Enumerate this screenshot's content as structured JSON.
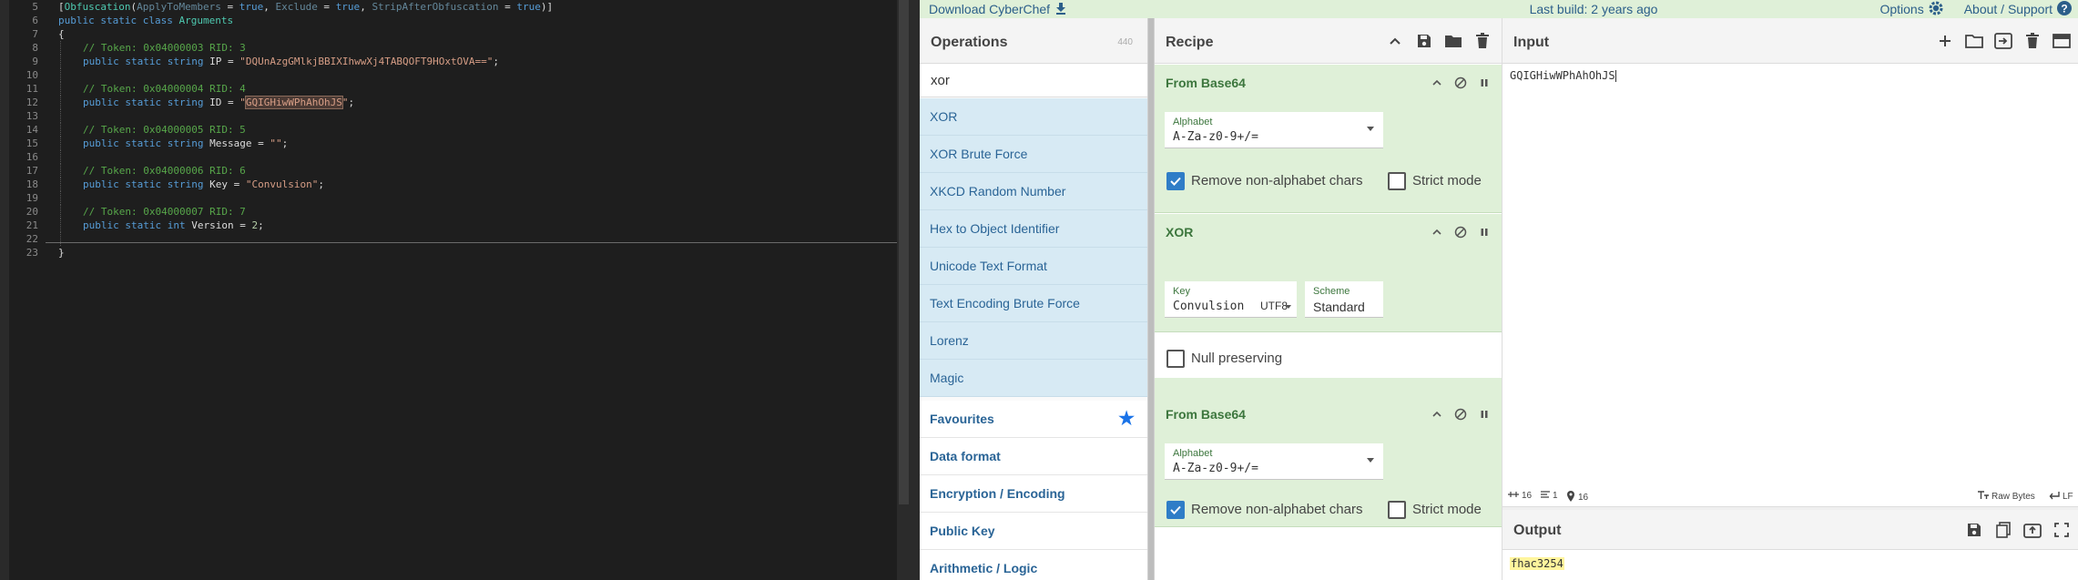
{
  "editor": {
    "lines": [
      {
        "n": "5",
        "parts": [
          [
            "[",
            ""
          ],
          [
            "Obfuscation",
            "cls"
          ],
          [
            "(",
            ""
          ],
          [
            "ApplyToMembers",
            "prm"
          ],
          [
            " = ",
            ""
          ],
          [
            "true",
            "kw"
          ],
          [
            ", ",
            ""
          ],
          [
            "Exclude",
            "prm"
          ],
          [
            " = ",
            ""
          ],
          [
            "true",
            "kw"
          ],
          [
            ", ",
            ""
          ],
          [
            "StripAfterObfuscation",
            "prm"
          ],
          [
            " = ",
            ""
          ],
          [
            "true",
            "kw"
          ],
          [
            ")]",
            ""
          ]
        ]
      },
      {
        "n": "6",
        "parts": [
          [
            "public",
            "kw"
          ],
          [
            " ",
            ""
          ],
          [
            "static",
            "kw"
          ],
          [
            " ",
            ""
          ],
          [
            "class",
            "kw"
          ],
          [
            " ",
            ""
          ],
          [
            "Arguments",
            "cls"
          ]
        ]
      },
      {
        "n": "7",
        "parts": [
          [
            "{",
            ""
          ]
        ]
      },
      {
        "n": "8",
        "indent": true,
        "parts": [
          [
            "// Token: 0x04000003 RID: 3",
            "cmt"
          ]
        ]
      },
      {
        "n": "9",
        "indent": true,
        "parts": [
          [
            "public",
            "kw"
          ],
          [
            " ",
            ""
          ],
          [
            "static",
            "kw"
          ],
          [
            " ",
            ""
          ],
          [
            "string",
            "kw"
          ],
          [
            " IP = ",
            ""
          ],
          [
            "\"DQUnAzgGMlkjBBIXIhwwXj4TABQOFT9HOxtOVA==\"",
            "str"
          ],
          [
            ";",
            ""
          ]
        ]
      },
      {
        "n": "10",
        "parts": []
      },
      {
        "n": "11",
        "indent": true,
        "parts": [
          [
            "// Token: 0x04000004 RID: 4",
            "cmt"
          ]
        ]
      },
      {
        "n": "12",
        "indent": true,
        "parts": [
          [
            "public",
            "kw"
          ],
          [
            " ",
            ""
          ],
          [
            "static",
            "kw"
          ],
          [
            " ",
            ""
          ],
          [
            "string",
            "kw"
          ],
          [
            " ID = ",
            ""
          ],
          [
            "\"",
            "str"
          ],
          [
            "GQIGHiwWPhAhOhJS",
            "str hl"
          ],
          [
            "\"",
            "str"
          ],
          [
            ";",
            ""
          ]
        ]
      },
      {
        "n": "13",
        "parts": []
      },
      {
        "n": "14",
        "indent": true,
        "parts": [
          [
            "// Token: 0x04000005 RID: 5",
            "cmt"
          ]
        ]
      },
      {
        "n": "15",
        "indent": true,
        "parts": [
          [
            "public",
            "kw"
          ],
          [
            " ",
            ""
          ],
          [
            "static",
            "kw"
          ],
          [
            " ",
            ""
          ],
          [
            "string",
            "kw"
          ],
          [
            " Message = ",
            ""
          ],
          [
            "\"\"",
            "str"
          ],
          [
            ";",
            ""
          ]
        ]
      },
      {
        "n": "16",
        "parts": []
      },
      {
        "n": "17",
        "indent": true,
        "parts": [
          [
            "// Token: 0x04000006 RID: 6",
            "cmt"
          ]
        ]
      },
      {
        "n": "18",
        "indent": true,
        "parts": [
          [
            "public",
            "kw"
          ],
          [
            " ",
            ""
          ],
          [
            "static",
            "kw"
          ],
          [
            " ",
            ""
          ],
          [
            "string",
            "kw"
          ],
          [
            " Key = ",
            ""
          ],
          [
            "\"Convulsion\"",
            "str"
          ],
          [
            ";",
            ""
          ]
        ]
      },
      {
        "n": "19",
        "parts": []
      },
      {
        "n": "20",
        "indent": true,
        "parts": [
          [
            "// Token: 0x04000007 RID: 7",
            "cmt"
          ]
        ]
      },
      {
        "n": "21",
        "indent": true,
        "parts": [
          [
            "public",
            "kw"
          ],
          [
            " ",
            ""
          ],
          [
            "static",
            "kw"
          ],
          [
            " ",
            ""
          ],
          [
            "int",
            "kw"
          ],
          [
            " Version = ",
            ""
          ],
          [
            "2",
            "num"
          ],
          [
            ";",
            ""
          ]
        ]
      },
      {
        "n": "22",
        "parts": []
      },
      {
        "n": "23",
        "parts": [
          [
            "}",
            ""
          ]
        ]
      }
    ]
  },
  "banner": {
    "download": "Download CyberChef",
    "last_build": "Last build: 2 years ago",
    "options": "Options",
    "about": "About / Support"
  },
  "operations": {
    "title": "Operations",
    "count": "440",
    "search_value": "xor",
    "results": [
      "XOR",
      "XOR Brute Force",
      "XKCD Random Number",
      "Hex to Object Identifier",
      "Unicode Text Format",
      "Text Encoding Brute Force",
      "Lorenz",
      "Magic"
    ],
    "categories": [
      "Favourites",
      "Data format",
      "Encryption / Encoding",
      "Public Key",
      "Arithmetic / Logic"
    ]
  },
  "recipe": {
    "title": "Recipe",
    "ops": [
      {
        "title": "From Base64",
        "alphabet_label": "Alphabet",
        "alphabet_value": "A-Za-z0-9+/=",
        "remove_label": "Remove non-alphabet chars",
        "strict_label": "Strict mode"
      },
      {
        "title": "XOR",
        "key_label": "Key",
        "key_value": "Convulsion",
        "key_encoding": "UTF8",
        "scheme_label": "Scheme",
        "scheme_value": "Standard",
        "null_label": "Null preserving"
      },
      {
        "title": "From Base64",
        "alphabet_label": "Alphabet",
        "alphabet_value": "A-Za-z0-9+/=",
        "remove_label": "Remove non-alphabet chars",
        "strict_label": "Strict mode"
      }
    ]
  },
  "input": {
    "title": "Input",
    "value": "GQIGHiwWPhAhOhJS",
    "status": {
      "length": "16",
      "lines": "1",
      "position": "16",
      "raw_bytes": "Raw Bytes",
      "eol": "LF"
    }
  },
  "output": {
    "title": "Output",
    "value": "fhac3254"
  },
  "colors": {
    "recipe_bg": "#dff0d8",
    "search_result_bg": "#d7eaf4",
    "link_blue": "#2a6496",
    "output_highlight": "#fff59d"
  }
}
